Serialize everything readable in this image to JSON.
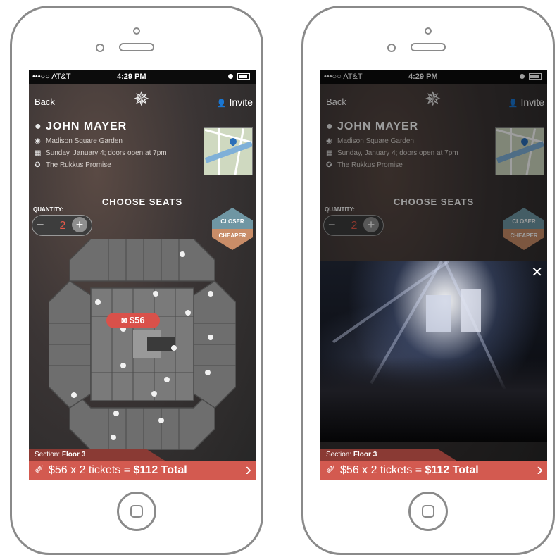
{
  "status_bar": {
    "carrier": "•••○○ AT&T",
    "time": "4:29 PM"
  },
  "nav": {
    "back_label": "Back",
    "invite_label": "Invite"
  },
  "event": {
    "artist": "JOHN MAYER",
    "venue": "Madison Square Garden",
    "date": "Sunday, January 4; doors open at 7pm",
    "promise": "The Rukkus Promise"
  },
  "seats": {
    "heading": "CHOOSE SEATS",
    "quantity_label": "QUANTITY:",
    "quantity": "2",
    "minus": "−",
    "plus": "+",
    "closer_label": "CLOSER",
    "cheaper_label": "CHEAPER",
    "price_pin": "$56"
  },
  "section": {
    "prefix": "Section: ",
    "name": "Floor 3"
  },
  "total": {
    "text": "$56 x 2 tickets = ",
    "total": "$112 Total"
  },
  "icons": {
    "logo": "rukkus-star-logo",
    "invite": "person-icon",
    "artist": "person-icon",
    "venue": "map-pin-icon",
    "date": "calendar-icon",
    "promise": "badge-icon",
    "ticket": "ticket-icon",
    "next": "chevron-right-icon",
    "close": "close-icon"
  },
  "colors": {
    "accent": "#d35a50",
    "closer": "#6f96a3",
    "cheaper": "#c98d68"
  }
}
